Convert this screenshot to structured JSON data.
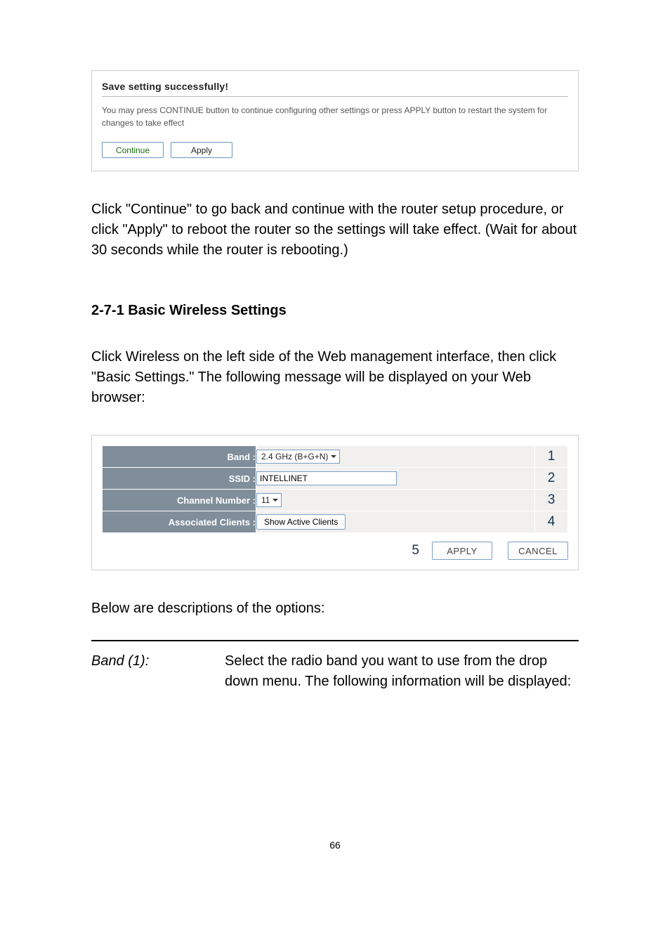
{
  "save_box": {
    "title": "Save setting successfully!",
    "desc": "You may press CONTINUE button to continue configuring other settings or press APPLY button to restart the system for changes to take effect",
    "continue_label": "Continue",
    "apply_label": "Apply"
  },
  "para1": "Click \"Continue\" to go back and continue with the router setup procedure, or click \"Apply\" to reboot the router so the settings will take effect. (Wait for about 30 seconds while the router is rebooting.)",
  "section_heading": "2-7-1 Basic Wireless Settings",
  "para2": "Click Wireless on the left side of the Web management interface, then click \"Basic Settings.\" The following message will be displayed on your Web browser:",
  "settings": {
    "band": {
      "label": "Band :",
      "value": "2.4 GHz (B+G+N)",
      "num": "1"
    },
    "ssid": {
      "label": "SSID :",
      "value": "INTELLINET",
      "num": "2"
    },
    "channel": {
      "label": "Channel Number :",
      "value": "11",
      "num": "3"
    },
    "clients": {
      "label": "Associated Clients :",
      "button": "Show Active Clients",
      "num": "4"
    },
    "actions": {
      "num": "5",
      "apply_label": "APPLY",
      "cancel_label": "CANCEL"
    }
  },
  "para3": "Below are descriptions of the options:",
  "option": {
    "key": "Band (1):",
    "val": "Select the radio band you want to use from the drop down menu. The following information will be displayed:"
  },
  "page_num": "66"
}
